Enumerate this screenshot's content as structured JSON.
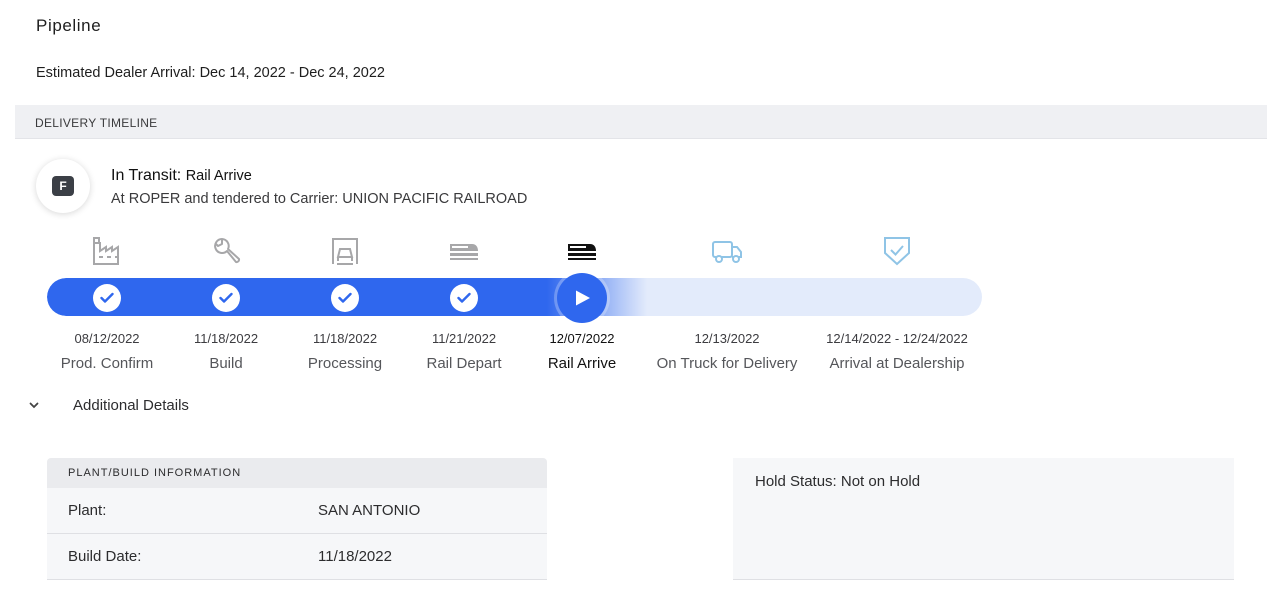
{
  "header": {
    "title": "Pipeline",
    "estimated_arrival": "Estimated Dealer Arrival: Dec 14, 2022 - Dec 24, 2022"
  },
  "timeline": {
    "section_label": "DELIVERY TIMELINE",
    "badge_letter": "F",
    "status_prefix": "In Transit:",
    "status_phase": "Rail Arrive",
    "status_detail": "At ROPER and tendered to Carrier: UNION PACIFIC RAILROAD",
    "progress_stage_index": 4,
    "colors": {
      "done": "#2f67ee",
      "pending": "#e3ebfb",
      "icon_done": "#a7a7a9",
      "icon_current": "#111111",
      "icon_pending": "#8fc4e6"
    },
    "stages": [
      {
        "name": "Prod. Confirm",
        "date": "08/12/2022",
        "state": "done",
        "icon": "factory-icon"
      },
      {
        "name": "Build",
        "date": "11/18/2022",
        "state": "done",
        "icon": "wrench-icon"
      },
      {
        "name": "Processing",
        "date": "11/18/2022",
        "state": "done",
        "icon": "car-processing-icon"
      },
      {
        "name": "Rail Depart",
        "date": "11/21/2022",
        "state": "done",
        "icon": "train-icon"
      },
      {
        "name": "Rail Arrive",
        "date": "12/07/2022",
        "state": "current",
        "icon": "train-icon"
      },
      {
        "name": "On Truck for Delivery",
        "date": "12/13/2022",
        "state": "pending",
        "icon": "truck-icon"
      },
      {
        "name": "Arrival at Dealership",
        "date": "12/14/2022 - 12/24/2022",
        "state": "pending",
        "icon": "shield-check-icon"
      }
    ]
  },
  "details": {
    "toggle_label": "Additional Details",
    "expanded": true,
    "plant": {
      "heading": "PLANT/BUILD INFORMATION",
      "rows": [
        {
          "label": "Plant:",
          "value": "SAN ANTONIO"
        },
        {
          "label": "Build Date:",
          "value": "11/18/2022"
        }
      ]
    },
    "hold_status": "Hold Status: Not on Hold"
  }
}
